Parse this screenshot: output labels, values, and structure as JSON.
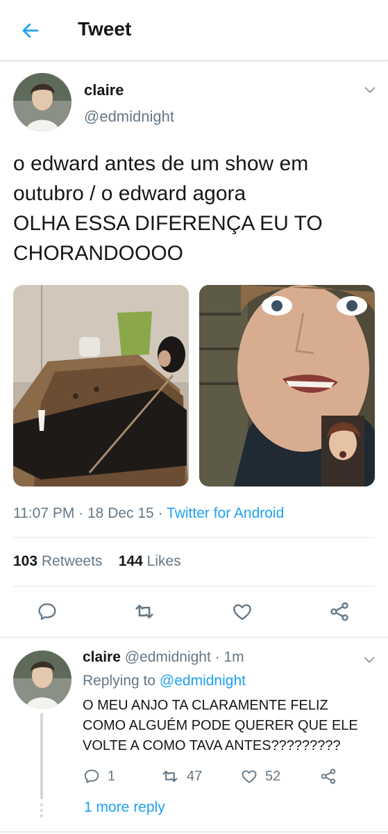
{
  "header": {
    "title": "Tweet",
    "back_icon": "arrow-left-icon"
  },
  "tweet": {
    "author_name": "claire",
    "author_handle": "@edmidnight",
    "text": "o edward antes de um show em\noutubro / o edward agora\nOLHA ESSA DIFERENÇA EU TO\nCHORANDOOOO",
    "photos": [
      "photo-person-lounging-backstage",
      "photo-selfie-facetime"
    ],
    "time": "11:07 PM",
    "date": "18 Dec 15",
    "client": "Twitter for Android",
    "retweets_count": "103",
    "retweets_label": "Retweets",
    "likes_count": "144",
    "likes_label": "Likes"
  },
  "reply": {
    "author_name": "claire",
    "author_handle": "@edmidnight",
    "time": "1m",
    "replying_label": "Replying to",
    "replying_to": "@edmidnight",
    "text": "O MEU ANJO TA CLARAMENTE FELIZ\nCOMO ALGUÉM PODE QUERER QUE ELE\nVOLTE A COMO TAVA ANTES?????????",
    "reply_count": "1",
    "retweet_count": "47",
    "like_count": "52",
    "more_replies": "1 more reply"
  },
  "colors": {
    "accent": "#1da1f2",
    "secondary_text": "#657786",
    "primary_text": "#14171a",
    "divider": "#e1e8ed"
  }
}
